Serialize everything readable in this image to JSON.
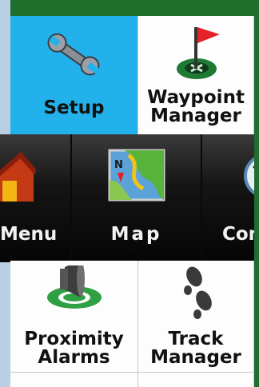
{
  "menu_grid": {
    "top_row": [
      {
        "label": "Setup",
        "icon": "wrench-icon",
        "selected": true
      },
      {
        "label": "Waypoint\nManager",
        "icon": "flag-icon"
      }
    ],
    "carousel": [
      {
        "label": "Menu",
        "icon": "home-icon"
      },
      {
        "label": "Map",
        "icon": "map-icon"
      },
      {
        "label": "Com",
        "icon": "compass-icon"
      }
    ],
    "bottom_row": [
      {
        "label": "Proximity\nAlarms",
        "icon": "speaker-icon"
      },
      {
        "label": "Track\nManager",
        "icon": "footprints-icon"
      }
    ]
  },
  "colors": {
    "selected": "#22b1ea",
    "background": "#fdfdfd",
    "bar": "#0d0d0d"
  }
}
